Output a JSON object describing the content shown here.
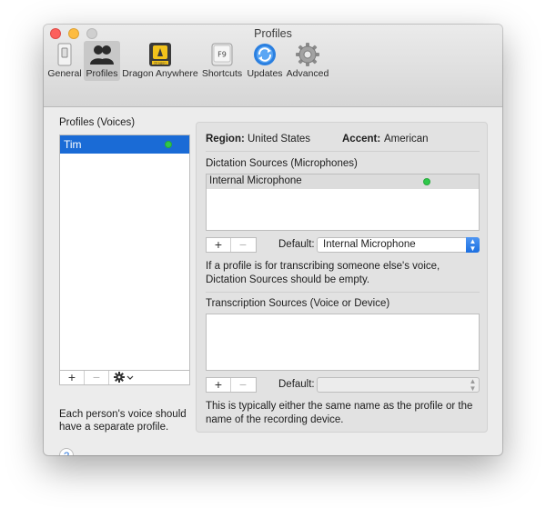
{
  "window": {
    "title": "Profiles"
  },
  "toolbar": {
    "items": [
      {
        "label": "General",
        "icon": "switch-icon"
      },
      {
        "label": "Profiles",
        "icon": "people-icon",
        "selected": true
      },
      {
        "label": "Dragon Anywhere",
        "icon": "dragon-icon",
        "badge": "Dragon"
      },
      {
        "label": "Shortcuts",
        "icon": "f9-key-icon",
        "key": "F9"
      },
      {
        "label": "Updates",
        "icon": "sync-icon"
      },
      {
        "label": "Advanced",
        "icon": "gear-icon"
      }
    ]
  },
  "profiles": {
    "title": "Profiles (Voices)",
    "items": [
      {
        "name": "Tim",
        "status_color": "#2fc84a"
      }
    ],
    "add_label": "+",
    "remove_label": "−",
    "note": "Each person's voice should have a separate profile.",
    "help_label": "?"
  },
  "details": {
    "region_label": "Region:",
    "region_value": "United States",
    "accent_label": "Accent:",
    "accent_value": "American",
    "dictation": {
      "title": "Dictation Sources (Microphones)",
      "items": [
        {
          "name": "Internal Microphone",
          "status_color": "#2fc84a"
        }
      ],
      "add_label": "+",
      "remove_label": "−",
      "default_label": "Default:",
      "default_value": "Internal Microphone",
      "note": "If a profile is for transcribing someone else's voice, Dictation Sources should be empty."
    },
    "transcription": {
      "title": "Transcription Sources (Voice or Device)",
      "add_label": "+",
      "remove_label": "−",
      "default_label": "Default:",
      "default_value": "",
      "note": "This is typically either the same name as the profile or the name of the recording device."
    }
  },
  "colors": {
    "selection": "#1a6bd6",
    "accent": "#1c6fe0"
  }
}
